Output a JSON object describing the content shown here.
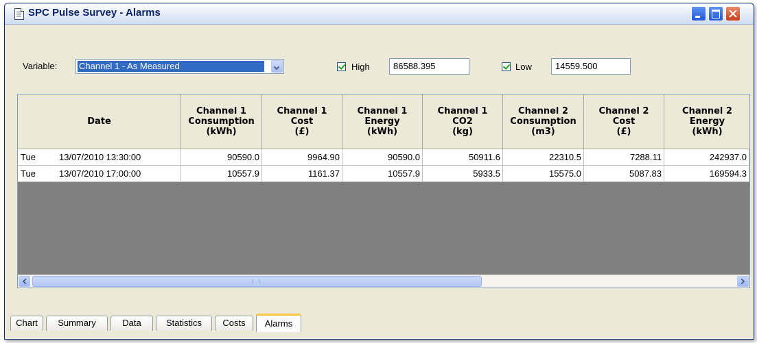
{
  "window": {
    "title": "SPC Pulse Survey - Alarms"
  },
  "toolbar": {
    "variable_label": "Variable:",
    "variable_value": "Channel 1 - As Measured",
    "high_checked": true,
    "high_label": "High",
    "high_value": "86588.395",
    "low_checked": true,
    "low_label": "Low",
    "low_value": "14559.500"
  },
  "table": {
    "columns": [
      "Date",
      "Channel 1\nConsumption\n(kWh)",
      "Channel 1\nCost\n(£)",
      "Channel 1\nEnergy\n(kWh)",
      "Channel 1\nCO2\n(kg)",
      "Channel 2\nConsumption\n(m3)",
      "Channel 2\nCost\n(£)",
      "Channel 2\nEnergy\n(kWh)"
    ],
    "rows": [
      {
        "day": "Tue",
        "datetime": "13/07/2010 13:30:00",
        "values": [
          "90590.0",
          "9964.90",
          "90590.0",
          "50911.6",
          "22310.5",
          "7288.11",
          "242937.0"
        ]
      },
      {
        "day": "Tue",
        "datetime": "13/07/2010 17:00:00",
        "values": [
          "10557.9",
          "1161.37",
          "10557.9",
          "5933.5",
          "15575.0",
          "5087.83",
          "169594.3"
        ]
      }
    ]
  },
  "tabs": [
    {
      "label": "Chart",
      "active": false
    },
    {
      "label": "Summary",
      "active": false
    },
    {
      "label": "Data",
      "active": false
    },
    {
      "label": "Statistics",
      "active": false
    },
    {
      "label": "Costs",
      "active": false
    },
    {
      "label": "Alarms",
      "active": true
    }
  ],
  "colors": {
    "title_text": "#0a246a",
    "selection": "#316ac5",
    "grid_empty": "#808080",
    "active_tab_accent": "#ffc83c",
    "check_mark": "#21a121"
  }
}
